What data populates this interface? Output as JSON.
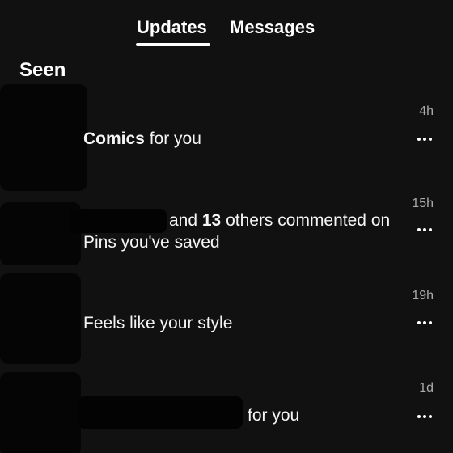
{
  "tabs": {
    "updates": "Updates",
    "messages": "Messages"
  },
  "section": {
    "title": "Seen"
  },
  "notifications": [
    {
      "bold": "Comics",
      "rest": " for you",
      "time": "4h"
    },
    {
      "pre": "and ",
      "bold": "13",
      "rest": " others commented on Pins you've saved",
      "time": "15h"
    },
    {
      "text": "Feels like your style",
      "time": "19h"
    },
    {
      "rest": "for you",
      "time": "1d"
    }
  ],
  "icons": {
    "more": "more-horizontal-icon"
  },
  "colors": {
    "background": "#111111",
    "text": "#ffffff",
    "muted": "#aaaaaa"
  }
}
